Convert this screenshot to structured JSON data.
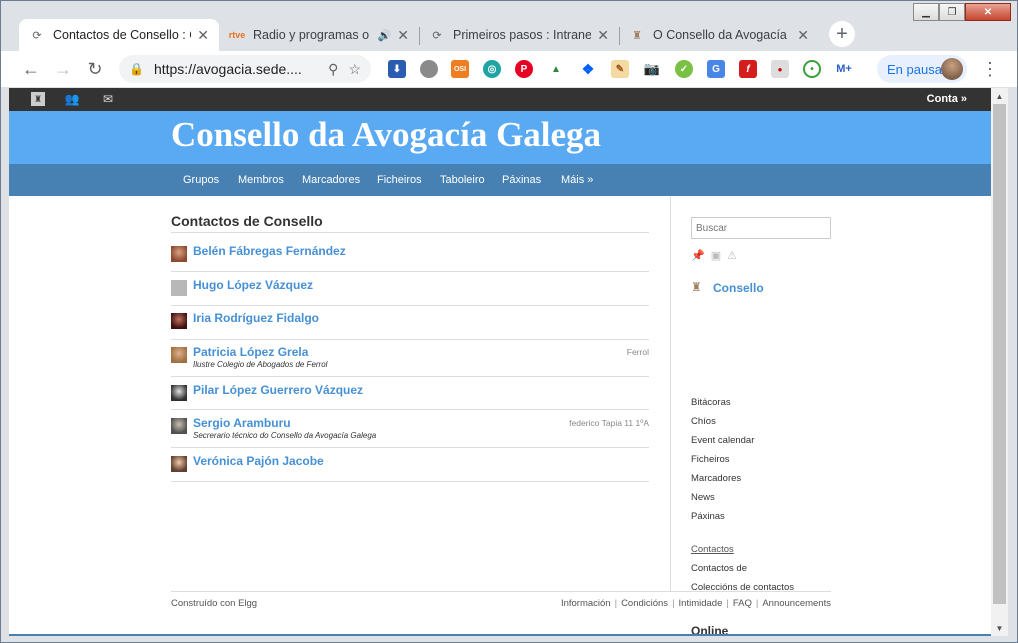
{
  "browser": {
    "tabs": [
      {
        "title": "Contactos de Consello : C",
        "favicon": "elgg-icon"
      },
      {
        "title": "Radio y programas o",
        "favicon": "rtve-icon"
      },
      {
        "title": "Primeiros pasos : Intranet",
        "favicon": "elgg-icon"
      },
      {
        "title": "O Consello da Avogacía C",
        "favicon": "consello-crest-icon"
      }
    ],
    "address": "https://avogacia.sede....",
    "profile_label": "En pausa"
  },
  "site": {
    "account": "Conta »",
    "title": "Consello da Avogacía Galega",
    "nav": [
      "Grupos",
      "Membros",
      "Marcadores",
      "Ficheiros",
      "Taboleiro",
      "Páxinas",
      "Máis »"
    ]
  },
  "main": {
    "heading": "Contactos de Consello",
    "contacts": [
      {
        "name": "Belén Fábregas Fernández",
        "brief": "",
        "location": ""
      },
      {
        "name": "Hugo López Vázquez",
        "brief": "",
        "location": ""
      },
      {
        "name": "Iria Rodríguez Fidalgo",
        "brief": "",
        "location": ""
      },
      {
        "name": "Patricia López Grela",
        "brief": "Ilustre Colegio de Abogados de Ferrol",
        "location": "Ferrol"
      },
      {
        "name": "Pilar López Guerrero Vázquez",
        "brief": "",
        "location": ""
      },
      {
        "name": "Sergio Aramburu",
        "brief": "Secrerario técnico do Consello da Avogacía Galega",
        "location": "federico Tapia 11 1ºA"
      },
      {
        "name": "Verónica Pajón Jacobe",
        "brief": "",
        "location": ""
      }
    ]
  },
  "sidebar": {
    "search_placeholder": "Buscar",
    "group_name": "Consello",
    "menu": [
      "Bitácoras",
      "Chíos",
      "Event calendar",
      "Ficheiros",
      "Marcadores",
      "News",
      "Páxinas"
    ],
    "contacts_link": "Contactos",
    "contacts_items": [
      "Contactos de",
      "Coleccións de contactos"
    ],
    "online_title": "Online"
  },
  "footer": {
    "powered": "Construído con Elgg",
    "links": [
      "Información",
      "Condicións",
      "Intimidade",
      "FAQ",
      "Announcements"
    ]
  },
  "colors": {
    "header_blue": "#5aa9f3",
    "nav_blue": "#4781b3",
    "link_blue": "#4690d6",
    "topbar": "#333333"
  }
}
